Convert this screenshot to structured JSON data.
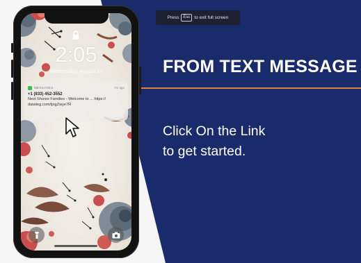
{
  "colors": {
    "slide_background": "#1a2b6b",
    "accent_rule": "#e0813a",
    "slide_text": "#ffffff",
    "phone_frame": "#121212",
    "message_app_icon": "#38c44c"
  },
  "fullscreen_hint": {
    "prefix": "Press",
    "key": "Esc",
    "suffix": "to exit full screen"
  },
  "slide": {
    "title": "FROM TEXT MESSAGE",
    "body_line_1": "Click On the Link",
    "body_line_2": "to get started."
  },
  "phone": {
    "lock_screen": {
      "time": "2:05",
      "date": "Wednesday, August 17",
      "lock_icon": "lock-icon",
      "flashlight_icon": "flashlight-icon",
      "camera_icon": "camera-icon"
    },
    "notification": {
      "app_name": "MESSAGES",
      "app_icon": "messages-icon",
      "time_ago": "7m ago",
      "sender": "+1 (833) 452-3552",
      "message_line_1": "Next Shores Families - Welcome to ... https://",
      "message_line_2": "daiwteg.com/ljngZwye7R"
    }
  }
}
